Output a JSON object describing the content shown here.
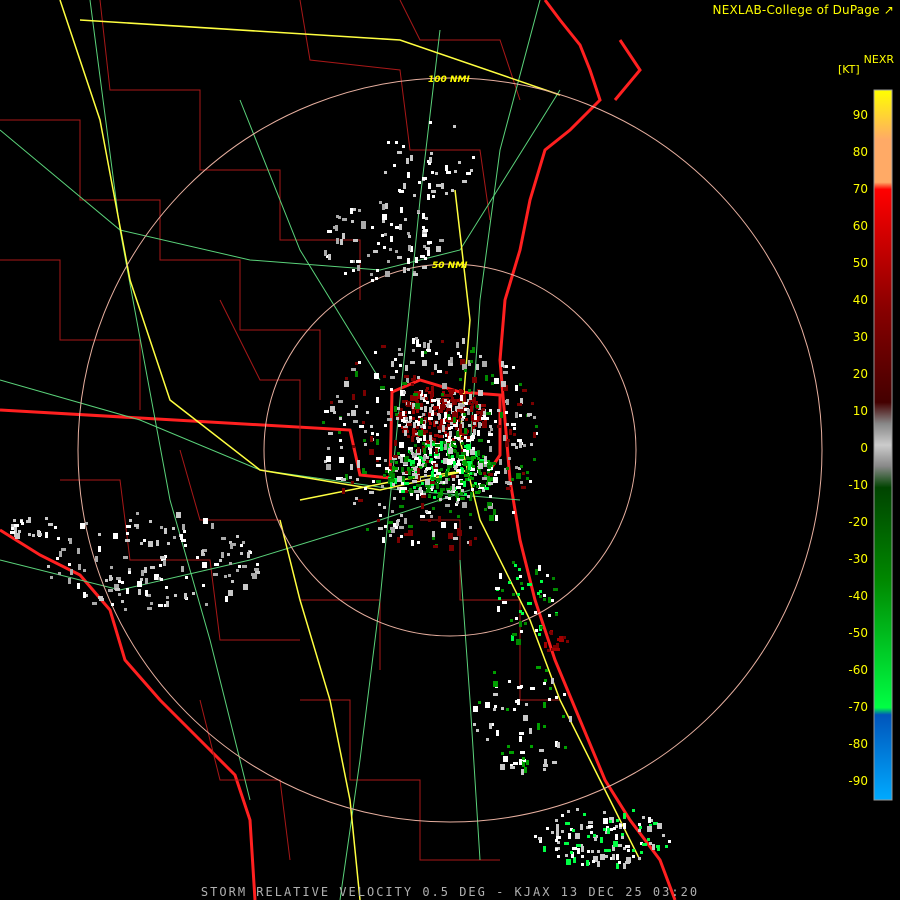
{
  "header": {
    "brand": "NEXLAB-College of DuPage",
    "brand_icon": "nexlab-logo-icon",
    "product": "NEXR",
    "units": "[KT]"
  },
  "map": {
    "range_rings": [
      {
        "label": "50 NMI"
      },
      {
        "label": "100 NMI"
      }
    ],
    "colors": {
      "state_borders": "#ff2020",
      "county_borders": "#b01818",
      "interstates": "#ffff40",
      "highways": "#5ad27a",
      "range_rings": "#e8b0a0"
    }
  },
  "legend": {
    "ticks": [
      "90",
      "80",
      "70",
      "60",
      "50",
      "40",
      "30",
      "20",
      "10",
      "0",
      "-10",
      "-20",
      "-30",
      "-40",
      "-50",
      "-60",
      "-70",
      "-80",
      "-90"
    ],
    "gradient": [
      "#00aaff",
      "#0055bb",
      "#00ff44",
      "#008800",
      "#004400",
      "#888888",
      "#cccccc",
      "#888888",
      "#440000",
      "#880000",
      "#ff0000",
      "#ffaa66",
      "#ffff00"
    ]
  },
  "footer": {
    "caption": "STORM RELATIVE VELOCITY 0.5 DEG - KJAX 13 DEC 25 03:20"
  }
}
